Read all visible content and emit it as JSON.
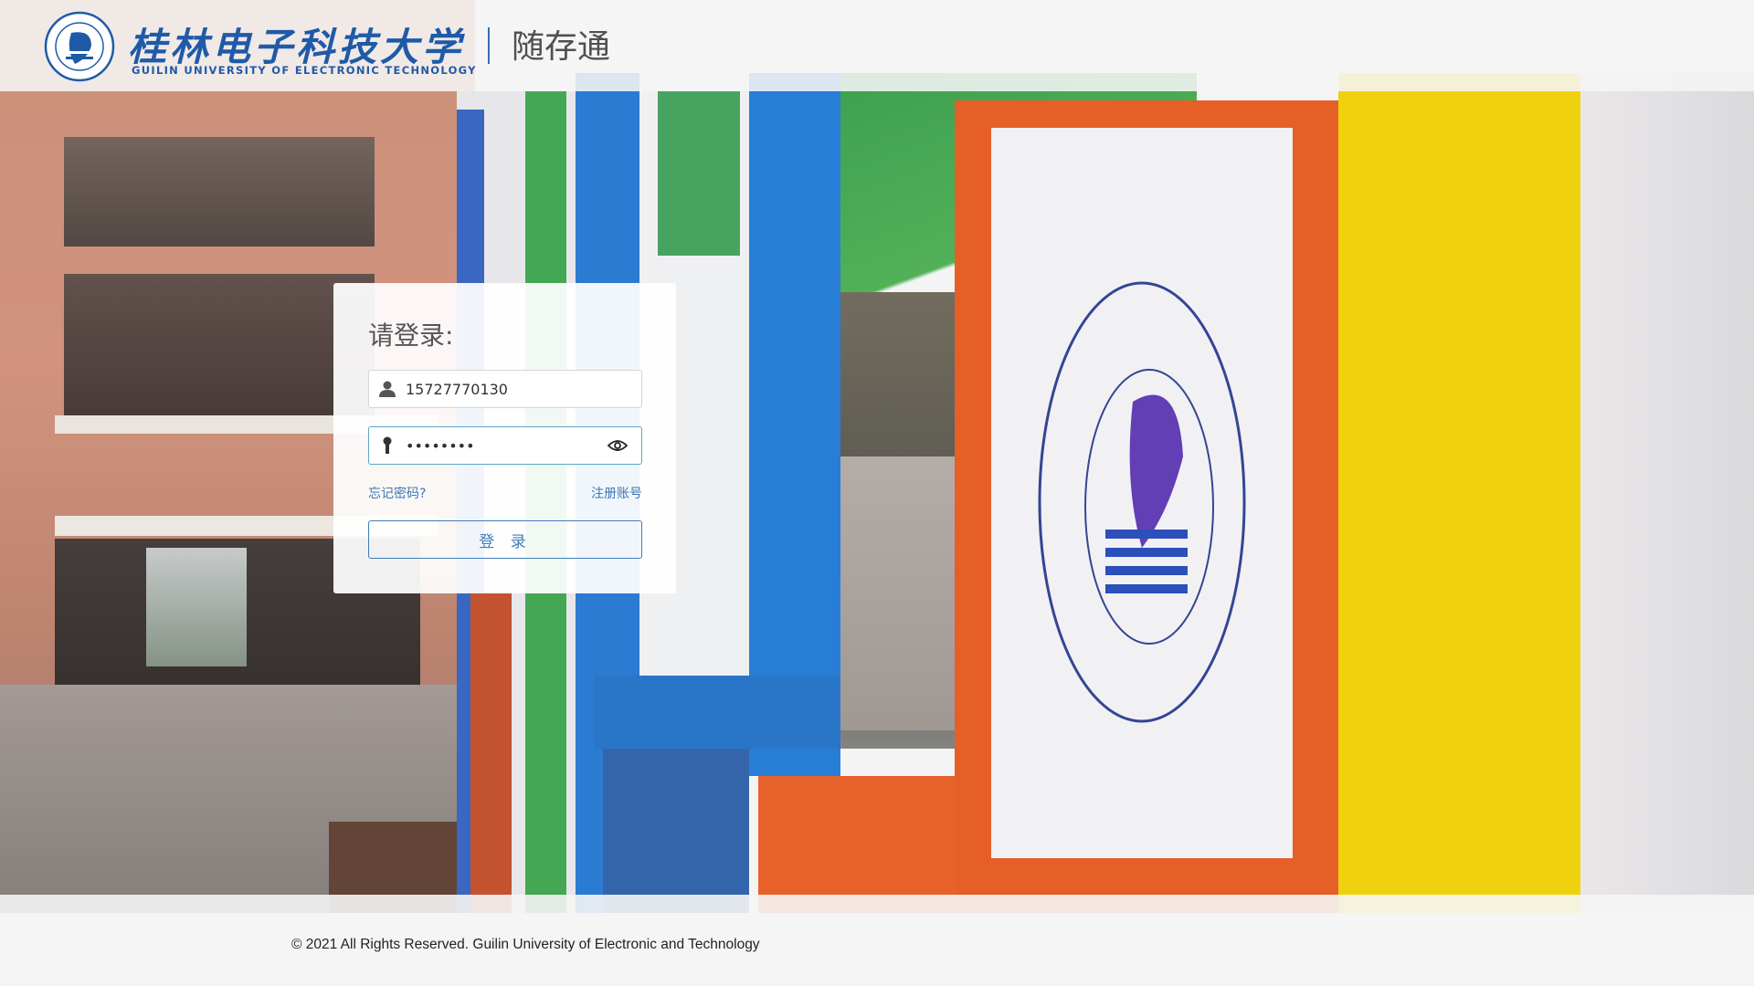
{
  "header": {
    "university_name_cn": "桂林电子科技大学",
    "university_name_en": "GUILIN UNIVERSITY OF ELECTRONIC TECHNOLOGY",
    "app_name": "随存通"
  },
  "login": {
    "title": "请登录:",
    "username_value": "15727770130",
    "password_mask": "••••••••",
    "forgot_password": "忘记密码?",
    "register": "注册账号",
    "submit": "登 录"
  },
  "footer": {
    "copyright": "© 2021 All Rights Reserved. Guilin University of Electronic and Technology"
  },
  "colors": {
    "brand_blue": "#1f5aa8",
    "link_blue": "#3d77b8",
    "focus_border": "#5aa7c4"
  }
}
